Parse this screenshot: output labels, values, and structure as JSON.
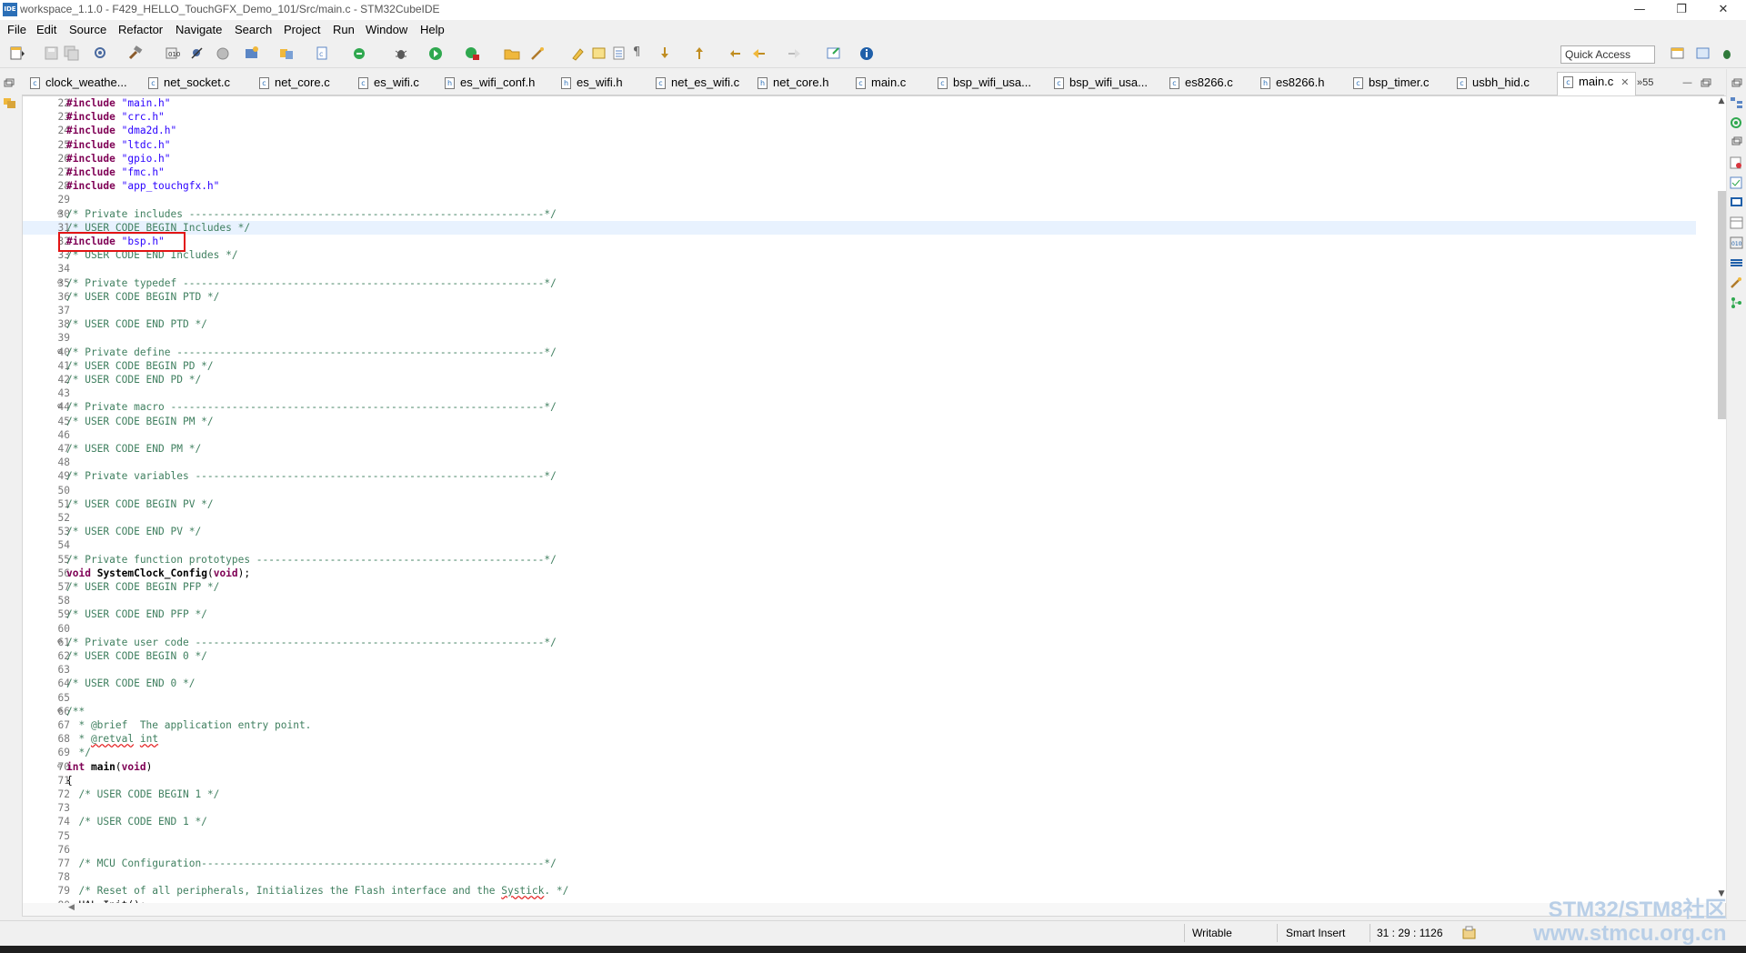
{
  "window": {
    "title": "workspace_1.1.0 - F429_HELLO_TouchGFX_Demo_101/Src/main.c - STM32CubeIDE",
    "app_icon": "IDE",
    "minimize": "—",
    "restore": "❐",
    "close": "✕"
  },
  "menu": [
    "File",
    "Edit",
    "Source",
    "Refactor",
    "Navigate",
    "Search",
    "Project",
    "Run",
    "Window",
    "Help"
  ],
  "toolbar": {
    "quick_access_placeholder": "Quick Access",
    "icons": [
      "new-icon",
      "save-icon",
      "save-all-icon",
      "build-config-icon",
      "build-icon",
      "build-target-icon",
      "debug-icon",
      "run-icon",
      "external-tools-icon",
      "open-type-icon",
      "search-icon",
      "info-icon"
    ]
  },
  "tabs": [
    {
      "label": "clock_weathe...",
      "active": false
    },
    {
      "label": "net_socket.c",
      "active": false
    },
    {
      "label": "net_core.c",
      "active": false
    },
    {
      "label": "es_wifi.c",
      "active": false
    },
    {
      "label": "es_wifi_conf.h",
      "active": false
    },
    {
      "label": "es_wifi.h",
      "active": false
    },
    {
      "label": "net_es_wifi.c",
      "active": false
    },
    {
      "label": "net_core.h",
      "active": false
    },
    {
      "label": "main.c",
      "active": false
    },
    {
      "label": "bsp_wifi_usa...",
      "active": false
    },
    {
      "label": "bsp_wifi_usa...",
      "active": false
    },
    {
      "label": "es8266.c",
      "active": false
    },
    {
      "label": "es8266.h",
      "active": false
    },
    {
      "label": "bsp_timer.c",
      "active": false
    },
    {
      "label": "usbh_hid.c",
      "active": false
    },
    {
      "label": "main.c",
      "active": true
    }
  ],
  "tab_overflow": "»55",
  "editor": {
    "current_line": 31,
    "lines": [
      {
        "n": "22",
        "fold": "",
        "parts": [
          [
            "kw",
            "#include"
          ],
          [
            "plain",
            " "
          ],
          [
            "str",
            "\"main.h\""
          ]
        ]
      },
      {
        "n": "23",
        "fold": "",
        "parts": [
          [
            "kw",
            "#include"
          ],
          [
            "plain",
            " "
          ],
          [
            "str",
            "\"crc.h\""
          ]
        ]
      },
      {
        "n": "24",
        "fold": "",
        "parts": [
          [
            "kw",
            "#include"
          ],
          [
            "plain",
            " "
          ],
          [
            "str",
            "\"dma2d.h\""
          ]
        ]
      },
      {
        "n": "25",
        "fold": "",
        "parts": [
          [
            "kw",
            "#include"
          ],
          [
            "plain",
            " "
          ],
          [
            "str",
            "\"ltdc.h\""
          ]
        ]
      },
      {
        "n": "26",
        "fold": "",
        "parts": [
          [
            "kw",
            "#include"
          ],
          [
            "plain",
            " "
          ],
          [
            "str",
            "\"gpio.h\""
          ]
        ]
      },
      {
        "n": "27",
        "fold": "",
        "parts": [
          [
            "kw",
            "#include"
          ],
          [
            "plain",
            " "
          ],
          [
            "str",
            "\"fmc.h\""
          ]
        ]
      },
      {
        "n": "28",
        "fold": "",
        "parts": [
          [
            "kw",
            "#include"
          ],
          [
            "plain",
            " "
          ],
          [
            "str",
            "\"app_touchgfx.h\""
          ]
        ]
      },
      {
        "n": "29",
        "fold": "",
        "parts": []
      },
      {
        "n": "30",
        "fold": "⊖",
        "parts": [
          [
            "cm",
            "/* Private includes ----------------------------------------------------------*/"
          ]
        ]
      },
      {
        "n": "31",
        "fold": "",
        "parts": [
          [
            "cm",
            "/* USER CODE BEGIN Includes */"
          ]
        ]
      },
      {
        "n": "32",
        "fold": "",
        "parts": [
          [
            "kw",
            "#include"
          ],
          [
            "plain",
            " "
          ],
          [
            "str",
            "\"bsp.h\""
          ]
        ]
      },
      {
        "n": "33",
        "fold": "",
        "parts": [
          [
            "cm",
            "/* USER CODE END Includes */"
          ]
        ]
      },
      {
        "n": "34",
        "fold": "",
        "parts": []
      },
      {
        "n": "35",
        "fold": "⊖",
        "parts": [
          [
            "cm",
            "/* Private typedef -----------------------------------------------------------*/"
          ]
        ]
      },
      {
        "n": "36",
        "fold": "",
        "parts": [
          [
            "cm",
            "/* USER CODE BEGIN PTD */"
          ]
        ]
      },
      {
        "n": "37",
        "fold": "",
        "parts": []
      },
      {
        "n": "38",
        "fold": "",
        "parts": [
          [
            "cm",
            "/* USER CODE END PTD */"
          ]
        ]
      },
      {
        "n": "39",
        "fold": "",
        "parts": []
      },
      {
        "n": "40",
        "fold": "⊖",
        "parts": [
          [
            "cm",
            "/* Private define ------------------------------------------------------------*/"
          ]
        ]
      },
      {
        "n": "41",
        "fold": "",
        "parts": [
          [
            "cm",
            "/* USER CODE BEGIN PD */"
          ]
        ]
      },
      {
        "n": "42",
        "fold": "",
        "parts": [
          [
            "cm",
            "/* USER CODE END PD */"
          ]
        ]
      },
      {
        "n": "43",
        "fold": "",
        "parts": []
      },
      {
        "n": "44",
        "fold": "⊖",
        "parts": [
          [
            "cm",
            "/* Private macro -------------------------------------------------------------*/"
          ]
        ]
      },
      {
        "n": "45",
        "fold": "",
        "parts": [
          [
            "cm",
            "/* USER CODE BEGIN PM */"
          ]
        ]
      },
      {
        "n": "46",
        "fold": "",
        "parts": []
      },
      {
        "n": "47",
        "fold": "",
        "parts": [
          [
            "cm",
            "/* USER CODE END PM */"
          ]
        ]
      },
      {
        "n": "48",
        "fold": "",
        "parts": []
      },
      {
        "n": "49",
        "fold": "",
        "parts": [
          [
            "cm",
            "/* Private variables ---------------------------------------------------------*/"
          ]
        ]
      },
      {
        "n": "50",
        "fold": "",
        "parts": []
      },
      {
        "n": "51",
        "fold": "",
        "parts": [
          [
            "cm",
            "/* USER CODE BEGIN PV */"
          ]
        ]
      },
      {
        "n": "52",
        "fold": "",
        "parts": []
      },
      {
        "n": "53",
        "fold": "",
        "parts": [
          [
            "cm",
            "/* USER CODE END PV */"
          ]
        ]
      },
      {
        "n": "54",
        "fold": "",
        "parts": []
      },
      {
        "n": "55",
        "fold": "",
        "parts": [
          [
            "cm",
            "/* Private function prototypes -----------------------------------------------*/"
          ]
        ]
      },
      {
        "n": "56",
        "fold": "",
        "parts": [
          [
            "kw",
            "void"
          ],
          [
            "plain",
            " "
          ],
          [
            "plainb",
            "SystemClock_Config"
          ],
          [
            "plain",
            "("
          ],
          [
            "kw",
            "void"
          ],
          [
            "plain",
            ");"
          ]
        ]
      },
      {
        "n": "57",
        "fold": "",
        "parts": [
          [
            "cm",
            "/* USER CODE BEGIN PFP */"
          ]
        ]
      },
      {
        "n": "58",
        "fold": "",
        "parts": []
      },
      {
        "n": "59",
        "fold": "",
        "parts": [
          [
            "cm",
            "/* USER CODE END PFP */"
          ]
        ]
      },
      {
        "n": "60",
        "fold": "",
        "parts": []
      },
      {
        "n": "61",
        "fold": "⊖",
        "parts": [
          [
            "cm",
            "/* Private user code ---------------------------------------------------------*/"
          ]
        ]
      },
      {
        "n": "62",
        "fold": "",
        "parts": [
          [
            "cm",
            "/* USER CODE BEGIN 0 */"
          ]
        ]
      },
      {
        "n": "63",
        "fold": "",
        "parts": []
      },
      {
        "n": "64",
        "fold": "",
        "parts": [
          [
            "cm",
            "/* USER CODE END 0 */"
          ]
        ]
      },
      {
        "n": "65",
        "fold": "",
        "parts": []
      },
      {
        "n": "66",
        "fold": "⊖",
        "parts": [
          [
            "cm",
            "/**"
          ]
        ]
      },
      {
        "n": "67",
        "fold": "",
        "parts": [
          [
            "cm",
            "  * @brief  The application entry point."
          ]
        ]
      },
      {
        "n": "68",
        "fold": "",
        "parts": [
          [
            "cm",
            "  * "
          ],
          [
            "cmsq",
            "@retval"
          ],
          [
            "cm",
            " "
          ],
          [
            "cmsq",
            "int"
          ]
        ]
      },
      {
        "n": "69",
        "fold": "",
        "parts": [
          [
            "cm",
            "  */"
          ]
        ]
      },
      {
        "n": "70",
        "fold": "⊖",
        "parts": [
          [
            "kw",
            "int"
          ],
          [
            "plain",
            " "
          ],
          [
            "plainb",
            "main"
          ],
          [
            "plain",
            "("
          ],
          [
            "kw",
            "void"
          ],
          [
            "plain",
            ")"
          ]
        ]
      },
      {
        "n": "71",
        "fold": "",
        "parts": [
          [
            "plain",
            "{"
          ]
        ]
      },
      {
        "n": "72",
        "fold": "",
        "parts": [
          [
            "cm",
            "  /* USER CODE BEGIN 1 */"
          ]
        ]
      },
      {
        "n": "73",
        "fold": "",
        "parts": []
      },
      {
        "n": "74",
        "fold": "",
        "parts": [
          [
            "cm",
            "  /* USER CODE END 1 */"
          ]
        ]
      },
      {
        "n": "75",
        "fold": "",
        "parts": []
      },
      {
        "n": "76",
        "fold": "",
        "parts": []
      },
      {
        "n": "77",
        "fold": "",
        "parts": [
          [
            "cm",
            "  /* MCU Configuration--------------------------------------------------------*/"
          ]
        ]
      },
      {
        "n": "78",
        "fold": "",
        "parts": []
      },
      {
        "n": "79",
        "fold": "",
        "parts": [
          [
            "cm",
            "  /* Reset of all peripherals, Initializes the Flash interface and the "
          ],
          [
            "cmsq",
            "Systick"
          ],
          [
            "cm",
            ". */"
          ]
        ]
      },
      {
        "n": "80",
        "fold": "",
        "parts": [
          [
            "plain",
            "  HAL_Init();"
          ]
        ]
      }
    ]
  },
  "status": {
    "mode": "Writable",
    "insert": "Smart Insert",
    "position": "31 : 29 : 1126"
  },
  "watermark": {
    "line1": "STM32/STM8社区",
    "line2": "www.stmcu.org.cn"
  }
}
